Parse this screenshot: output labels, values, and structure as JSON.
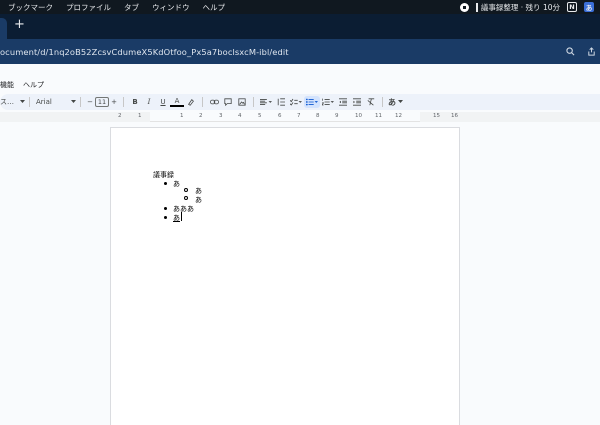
{
  "os_menubar": {
    "items": [
      "ブックマーク",
      "プロファイル",
      "タブ",
      "ウィンドウ",
      "ヘルプ"
    ],
    "status_text": "議事録整理 · 残り 10分",
    "n_badge": "N",
    "ime_badge": "あ"
  },
  "browser": {
    "new_tab_label": "+",
    "url": "ocument/d/1nq2oB52ZcsvCdumeX5KdOtfoo_Px5a7boclsxcM-ibl/edit"
  },
  "docs_menu": {
    "items": [
      "機能",
      "ヘルプ"
    ]
  },
  "toolbar": {
    "style_partial": "ス…",
    "font": "Arial",
    "font_size": "11",
    "minus": "−",
    "plus": "+",
    "bold": "B",
    "italic": "I",
    "underline": "U",
    "text_color": "A",
    "input_tool": "あ"
  },
  "ruler": {
    "numbers": [
      "2",
      "1",
      "1",
      "2",
      "3",
      "4",
      "5",
      "6",
      "7",
      "8",
      "9",
      "10",
      "11",
      "12",
      "13",
      "14",
      "15",
      "16",
      "17",
      "18"
    ]
  },
  "document": {
    "title": "議事録",
    "items": [
      {
        "level": 1,
        "text": "あ"
      },
      {
        "level": 2,
        "text": "あ"
      },
      {
        "level": 2,
        "text": "あ"
      },
      {
        "level": 1,
        "text": "あああ"
      },
      {
        "level": 1,
        "text": "あ"
      }
    ]
  }
}
